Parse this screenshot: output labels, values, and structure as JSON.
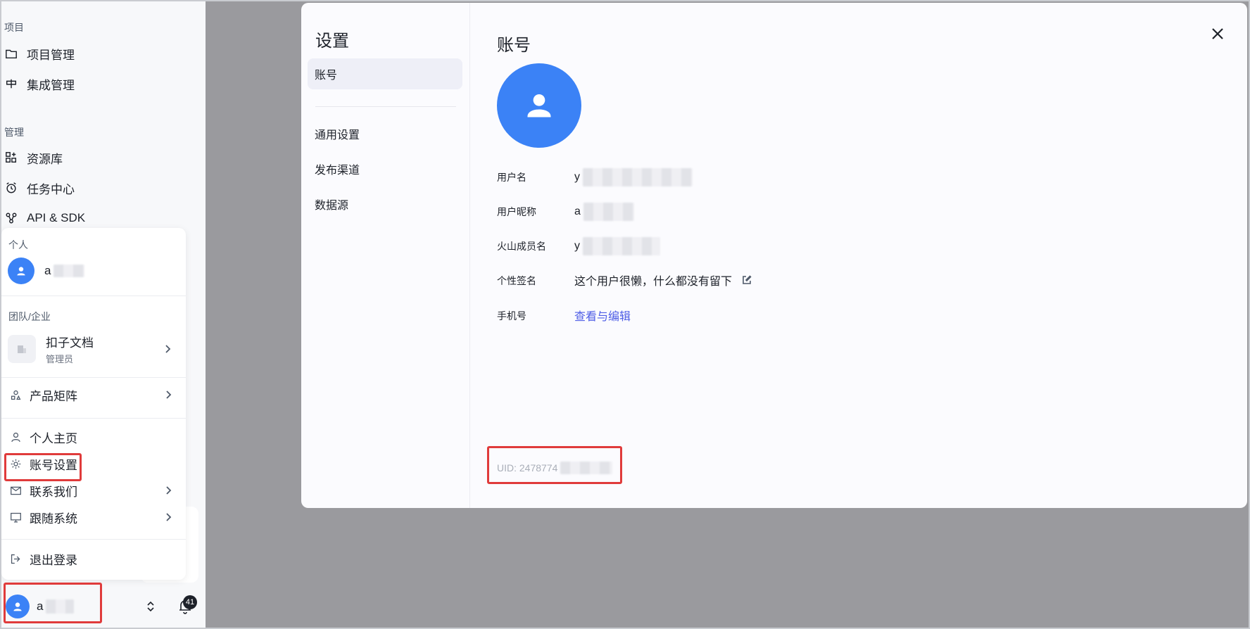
{
  "sidebar": {
    "section_project": "项目",
    "project_items": [
      {
        "label": "项目管理",
        "icon": "folder-icon"
      },
      {
        "label": "集成管理",
        "icon": "integration-icon"
      }
    ],
    "section_manage": "管理",
    "manage_items": [
      {
        "label": "资源库",
        "icon": "grid-plus-icon"
      },
      {
        "label": "任务中心",
        "icon": "alarm-clock-icon"
      },
      {
        "label": "API & SDK",
        "icon": "api-icon"
      }
    ],
    "user_name": "a",
    "notification_count": "41"
  },
  "popover": {
    "section_personal": "个人",
    "personal_name": "a",
    "section_team": "团队/企业",
    "team_name": "扣子文档",
    "team_role": "管理员",
    "items": {
      "product_matrix": "产品矩阵",
      "profile": "个人主页",
      "account_settings": "账号设置",
      "contact": "联系我们",
      "theme": "跟随系统",
      "logout": "退出登录"
    }
  },
  "settings_modal": {
    "title": "设置",
    "nav": [
      "账号",
      "通用设置",
      "发布渠道",
      "数据源"
    ],
    "active_nav": "账号",
    "content_title": "账号",
    "fields": {
      "username_label": "用户名",
      "username_value": "y",
      "nickname_label": "用户昵称",
      "nickname_value": "a",
      "volc_member_label": "火山成员名",
      "volc_member_value": "y",
      "signature_label": "个性签名",
      "signature_value": "这个用户很懒，什么都没有留下",
      "phone_label": "手机号",
      "phone_link": "查看与编辑"
    },
    "uid_text": "UID: 2478774"
  },
  "colors": {
    "accent_blue": "#3b82f6",
    "link": "#4f5ee6",
    "highlight_red": "#e03b3b",
    "overlay": "#9a9a9e"
  }
}
